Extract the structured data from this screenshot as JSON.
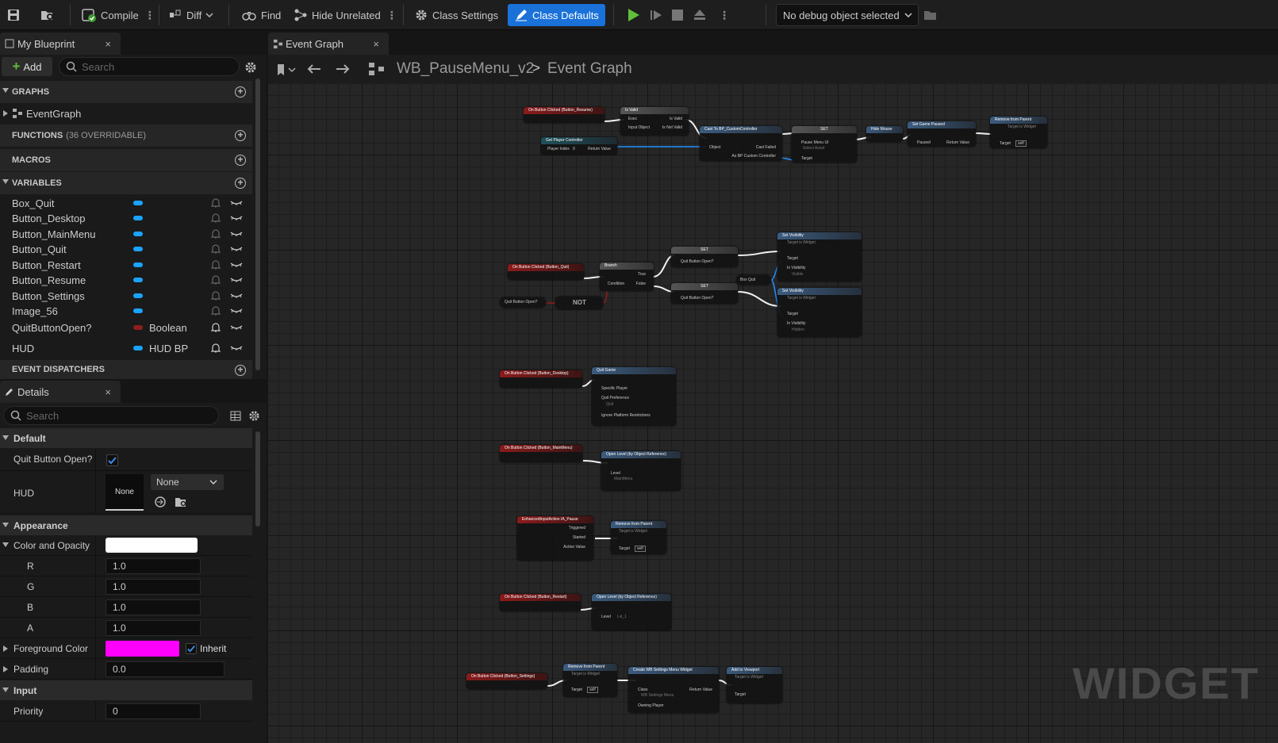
{
  "toolbar": {
    "compile": "Compile",
    "diff": "Diff",
    "find": "Find",
    "hide_unrelated": "Hide Unrelated",
    "class_settings": "Class Settings",
    "class_defaults": "Class Defaults",
    "debug_object": "No debug object selected"
  },
  "my_blueprint": {
    "tab_title": "My Blueprint",
    "close": "×",
    "add_label": "Add",
    "search_placeholder": "Search",
    "sections": {
      "graphs": "GRAPHS",
      "functions": "FUNCTIONS",
      "functions_sub": "(36 OVERRIDABLE)",
      "macros": "MACROS",
      "variables": "VARIABLES",
      "event_dispatchers": "EVENT DISPATCHERS"
    },
    "graph_items": [
      "EventGraph"
    ],
    "variables": [
      {
        "name": "Box_Quit",
        "type": ""
      },
      {
        "name": "Button_Desktop",
        "type": ""
      },
      {
        "name": "Button_MainMenu",
        "type": ""
      },
      {
        "name": "Button_Quit",
        "type": ""
      },
      {
        "name": "Button_Restart",
        "type": ""
      },
      {
        "name": "Button_Resume",
        "type": ""
      },
      {
        "name": "Button_Settings",
        "type": ""
      },
      {
        "name": "Image_56",
        "type": ""
      },
      {
        "name": "QuitButtonOpen?",
        "type": "Boolean"
      },
      {
        "name": "HUD",
        "type": "HUD BP"
      }
    ]
  },
  "details": {
    "tab_title": "Details",
    "close": "×",
    "search_placeholder": "Search",
    "sections": {
      "default": "Default",
      "appearance": "Appearance",
      "input": "Input"
    },
    "quit_button_open_label": "Quit Button Open?",
    "quit_button_open_checked": true,
    "hud_label": "HUD",
    "hud_thumb": "None",
    "hud_select": "None",
    "color_opacity_label": "Color and Opacity",
    "color_opacity_value": "#ffffff",
    "r_label": "R",
    "r": "1.0",
    "g_label": "G",
    "g": "1.0",
    "b_label": "B",
    "b": "1.0",
    "a_label": "A",
    "a": "1.0",
    "foreground_label": "Foreground Color",
    "foreground_value": "#ff00ff",
    "inherit_label": "Inherit",
    "padding_label": "Padding",
    "padding": "0.0",
    "priority_label": "Priority",
    "priority": "0"
  },
  "graph": {
    "tab_title": "Event Graph",
    "close": "×",
    "breadcrumb_blueprint": "WB_PauseMenu_v2",
    "breadcrumb_sep": ">",
    "breadcrumb_graph": "Event Graph",
    "watermark": "WIDGET",
    "nodes": {
      "n1": "On Button Clicked (Button_Resume)",
      "n2": "Is Valid",
      "n2_exec": "Exec",
      "n2_valid": "Is Valid",
      "n2_input": "Input Object",
      "n2_notvalid": "Is Not Valid",
      "n3": "Get Player Controller",
      "n3_pin": "Player Index",
      "n3_pin_val": "0",
      "n3_out": "Return Value",
      "n4": "Cast To BP_CustomController",
      "n4_obj": "Object",
      "n4_fail": "Cast Failed",
      "n4_as": "As BP Custom Controller",
      "n5": "SET",
      "n5_pin": "Pause Menu UI",
      "n5_val": "Select Asset",
      "n5_target": "Target",
      "n6": "Hide Mouse",
      "n7": "Set Game Paused",
      "n7_pin": "Paused",
      "n7_out": "Return Value",
      "n8": "Remove from Parent",
      "n8_sub": "Target is Widget",
      "n8_target": "Target",
      "n8_self": "self",
      "q1": "On Button Clicked (Button_Quit)",
      "q2": "Branch",
      "q2_cond": "Condition",
      "q2_true": "True",
      "q2_false": "False",
      "q3": "Quit Button Open?",
      "q4": "NOT",
      "q5": "SET",
      "q5_pin": "Quit Button Open?",
      "q6": "SET",
      "q6_pin": "Quit Button Open?",
      "q7": "Box Quit",
      "q8": "Set Visibility",
      "q8_sub": "Target is Widget",
      "q8_target": "Target",
      "q8_vis": "In Visibility",
      "q8_visval": "Visible",
      "q9": "Set Visibility",
      "q9_sub": "Target is Widget",
      "q9_target": "Target",
      "q9_vis": "In Visibility",
      "q9_visval": "Hidden",
      "d1": "On Button Clicked (Button_Desktop)",
      "d2": "Quit Game",
      "d2_p1": "Specific Player",
      "d2_p2": "Quit Preference",
      "d2_p2val": "Quit",
      "d2_p3": "Ignore Platform Restrictions",
      "m1": "On Button Clicked (Button_MainMenu)",
      "m2": "Open Level (by Object Reference)",
      "m2_level": "Level",
      "m2_val": "MainMenu",
      "i1": "EnhancedInputAction IA_Pause",
      "i1_trig": "Triggered",
      "i1_start": "Started",
      "i1_val": "Action Value",
      "i2": "Remove from Parent",
      "i2_sub": "Target is Widget",
      "i2_target": "Target",
      "i2_self": "self",
      "r1": "On Button Clicked (Button_Restart)",
      "r2": "Open Level (by Object Reference)",
      "r2_level": "Level",
      "r2_val": "Lvl_1",
      "s1": "On Button Clicked (Button_Settings)",
      "s2": "Remove from Parent",
      "s2_sub": "Target is Widget",
      "s2_target": "Target",
      "s2_self": "self",
      "s3": "Create WB Settings Menu Widget",
      "s3_class": "Class",
      "s3_classval": "WB Settings Menu",
      "s3_out": "Return Value",
      "s3_owner": "Owning Player",
      "s4": "Add to Viewport",
      "s4_sub": "Target is Widget",
      "s4_target": "Target"
    }
  }
}
